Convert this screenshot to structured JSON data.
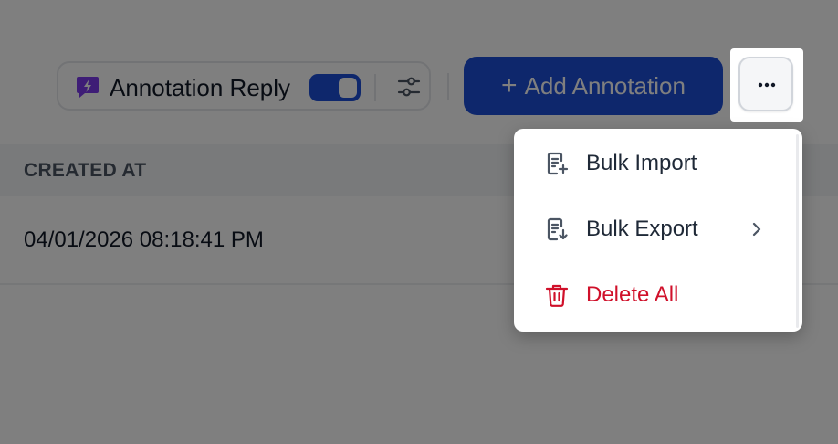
{
  "toolbar": {
    "annotation_reply_label": "Annotation Reply",
    "annotation_reply_enabled": true,
    "add_annotation_label": "Add Annotation",
    "add_icon_glyph": "+"
  },
  "table": {
    "columns": [
      "CREATED AT"
    ],
    "rows": [
      {
        "created_at": "04/01/2026 08:18:41 PM"
      }
    ]
  },
  "menu": {
    "items": [
      {
        "label": "Bulk Import",
        "icon": "file-import-icon",
        "has_submenu": false,
        "danger": false
      },
      {
        "label": "Bulk Export",
        "icon": "file-export-icon",
        "has_submenu": true,
        "danger": false
      },
      {
        "label": "Delete All",
        "icon": "trash-icon",
        "has_submenu": false,
        "danger": true
      }
    ]
  },
  "colors": {
    "primary": "#1d4ed8",
    "accent_purple": "#7c3aed",
    "danger": "#d0102a",
    "text": "#111827",
    "muted": "#4b5563"
  }
}
